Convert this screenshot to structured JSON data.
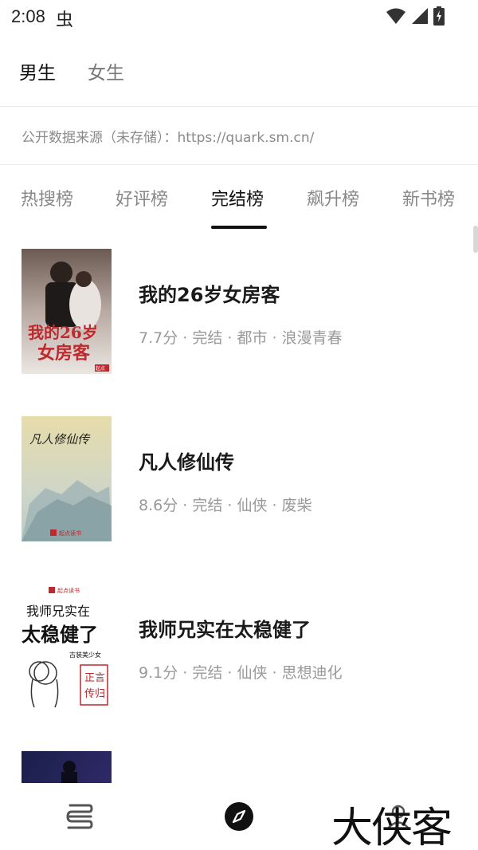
{
  "status_bar": {
    "time": "2:08",
    "bug_glyph": "虫"
  },
  "gender_tabs": [
    {
      "label": "男生",
      "active": true
    },
    {
      "label": "女生",
      "active": false
    }
  ],
  "source_note": "公开数据来源（未存储）：https://quark.sm.cn/",
  "rank_tabs": [
    {
      "label": "热搜榜",
      "active": false
    },
    {
      "label": "好评榜",
      "active": false
    },
    {
      "label": "完结榜",
      "active": true
    },
    {
      "label": "飙升榜",
      "active": false
    },
    {
      "label": "新书榜",
      "active": false
    }
  ],
  "books": [
    {
      "title": "我的26岁女房客",
      "meta": "7.7分 · 完结 · 都市 · 浪漫青春",
      "cover_text": {
        "line1": "我的26岁",
        "line2": "女房客",
        "small": "起点"
      }
    },
    {
      "title": "凡人修仙传",
      "meta": "8.6分 · 完结 · 仙侠 · 废柴",
      "cover_text": {
        "title": "凡人修仙传",
        "publisher": "起点读书"
      }
    },
    {
      "title": "我师兄实在太稳健了",
      "meta": "9.1分 · 完结 · 仙侠 · 思想迪化",
      "cover_text": {
        "publisher": "起点读书",
        "line1": "我师兄实在",
        "line2": "太稳健了",
        "tag": "古装美少女",
        "stamp1": "正言",
        "stamp2": "传归"
      }
    }
  ],
  "bottom_nav": {
    "items": [
      {
        "icon": "bookshelf-icon"
      },
      {
        "icon": "discover-compass-icon"
      },
      {
        "icon": "profile-icon"
      }
    ],
    "watermark": "大侠客"
  },
  "colors": {
    "active_text": "#111111",
    "inactive_text": "#888888",
    "meta_text": "#999999"
  }
}
